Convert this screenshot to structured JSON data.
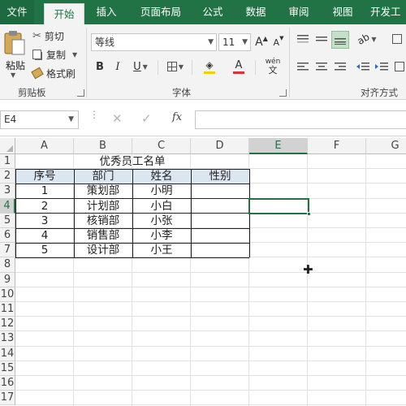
{
  "ribbon_tabs": [
    "文件",
    "开始",
    "插入",
    "页面布局",
    "公式",
    "数据",
    "审阅",
    "视图",
    "开发工"
  ],
  "active_tab": "开始",
  "clipboard": {
    "paste": "粘贴",
    "cut": "剪切",
    "copy": "复制",
    "format_painter": "格式刷",
    "group_label": "剪贴板"
  },
  "font": {
    "name": "等线",
    "size": "11",
    "bold": "B",
    "italic": "I",
    "underline": "U",
    "grow": "A",
    "shrink": "A",
    "color_letter": "A",
    "phonetic": "wén",
    "group_label": "字体",
    "font_color": "#e03030",
    "fill_color": "#f5d000"
  },
  "alignment": {
    "group_label": "对齐方式"
  },
  "formula_bar": {
    "name_box": "E4",
    "fx": "fx",
    "formula": ""
  },
  "grid": {
    "columns": [
      "A",
      "B",
      "C",
      "D",
      "E",
      "F",
      "G"
    ],
    "rows": [
      "1",
      "2",
      "3",
      "4",
      "5",
      "6",
      "7",
      "8",
      "9",
      "10",
      "11",
      "12",
      "13",
      "14",
      "15",
      "16",
      "17"
    ],
    "selected_column": "E",
    "selected_row": "4",
    "title": "优秀员工名单",
    "headers": [
      "序号",
      "部门",
      "姓名",
      "性别"
    ],
    "records": [
      [
        "1",
        "策划部",
        "小明",
        ""
      ],
      [
        "2",
        "计划部",
        "小白",
        ""
      ],
      [
        "3",
        "核销部",
        "小张",
        ""
      ],
      [
        "4",
        "销售部",
        "小李",
        ""
      ],
      [
        "5",
        "设计部",
        "小王",
        ""
      ]
    ],
    "header_fill": "#dce6f1",
    "accent": "#217346"
  }
}
